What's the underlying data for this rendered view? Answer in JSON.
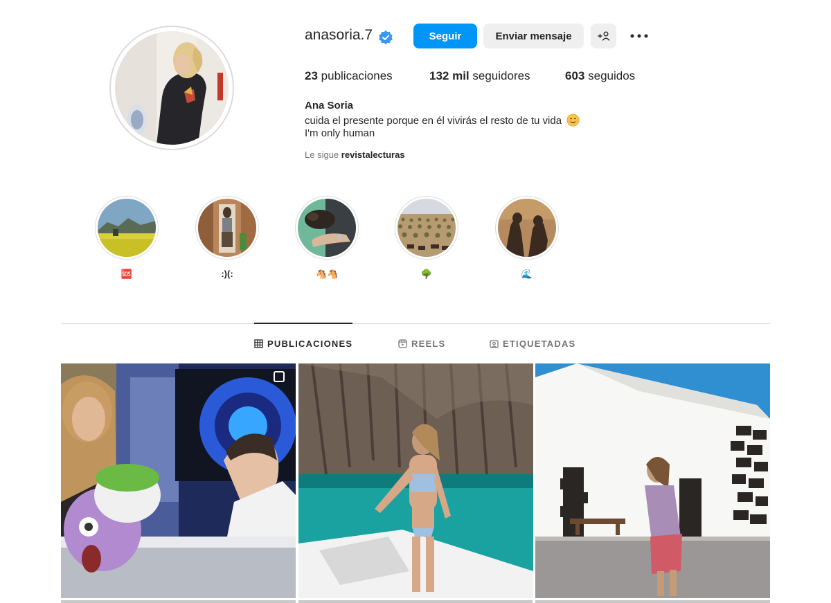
{
  "profile": {
    "username": "anasoria.7",
    "verified": true,
    "full_name": "Ana Soria",
    "bio_line_1": "cuida el presente porque en él vivirás el resto de tu vida",
    "bio_emoji": "smiling-face-emoji",
    "bio_line_2": "I'm only human",
    "followed_by_prefix": "Le sigue",
    "followed_by_user": "revistalecturas"
  },
  "actions": {
    "follow_label": "Seguir",
    "message_label": "Enviar mensaje",
    "add_user_icon": "add-user-icon",
    "more_label": "•••"
  },
  "stats": {
    "posts_count": "23",
    "posts_label": "publicaciones",
    "followers_count": "132 mil",
    "followers_label": "seguidores",
    "following_count": "603",
    "following_label": "seguidos"
  },
  "highlights": [
    {
      "label": "🆘",
      "image": "landscape-yellow-field"
    },
    {
      "label": ":)(:",
      "image": "mirror-selfie"
    },
    {
      "label": "🐴🐴",
      "image": "dog-and-hand"
    },
    {
      "label": "🌳",
      "image": "olive-field-horses"
    },
    {
      "label": "🌊",
      "image": "shadow-silhouettes"
    }
  ],
  "tabs": [
    {
      "label": "PUBLICACIONES",
      "icon": "grid-icon",
      "active": true
    },
    {
      "label": "REELS",
      "icon": "reels-icon",
      "active": false
    },
    {
      "label": "ETIQUETADAS",
      "icon": "tagged-icon",
      "active": false
    }
  ],
  "posts": [
    {
      "description": "tv-show-set",
      "multi": true
    },
    {
      "description": "woman-on-boat",
      "multi": false
    },
    {
      "description": "white-church",
      "multi": false
    }
  ],
  "colors": {
    "accent": "#0095f6",
    "verified": "#3897f0",
    "text": "#262626",
    "secondary_text": "#737373",
    "border": "#dbdbdb",
    "button_gray": "#efefef"
  }
}
